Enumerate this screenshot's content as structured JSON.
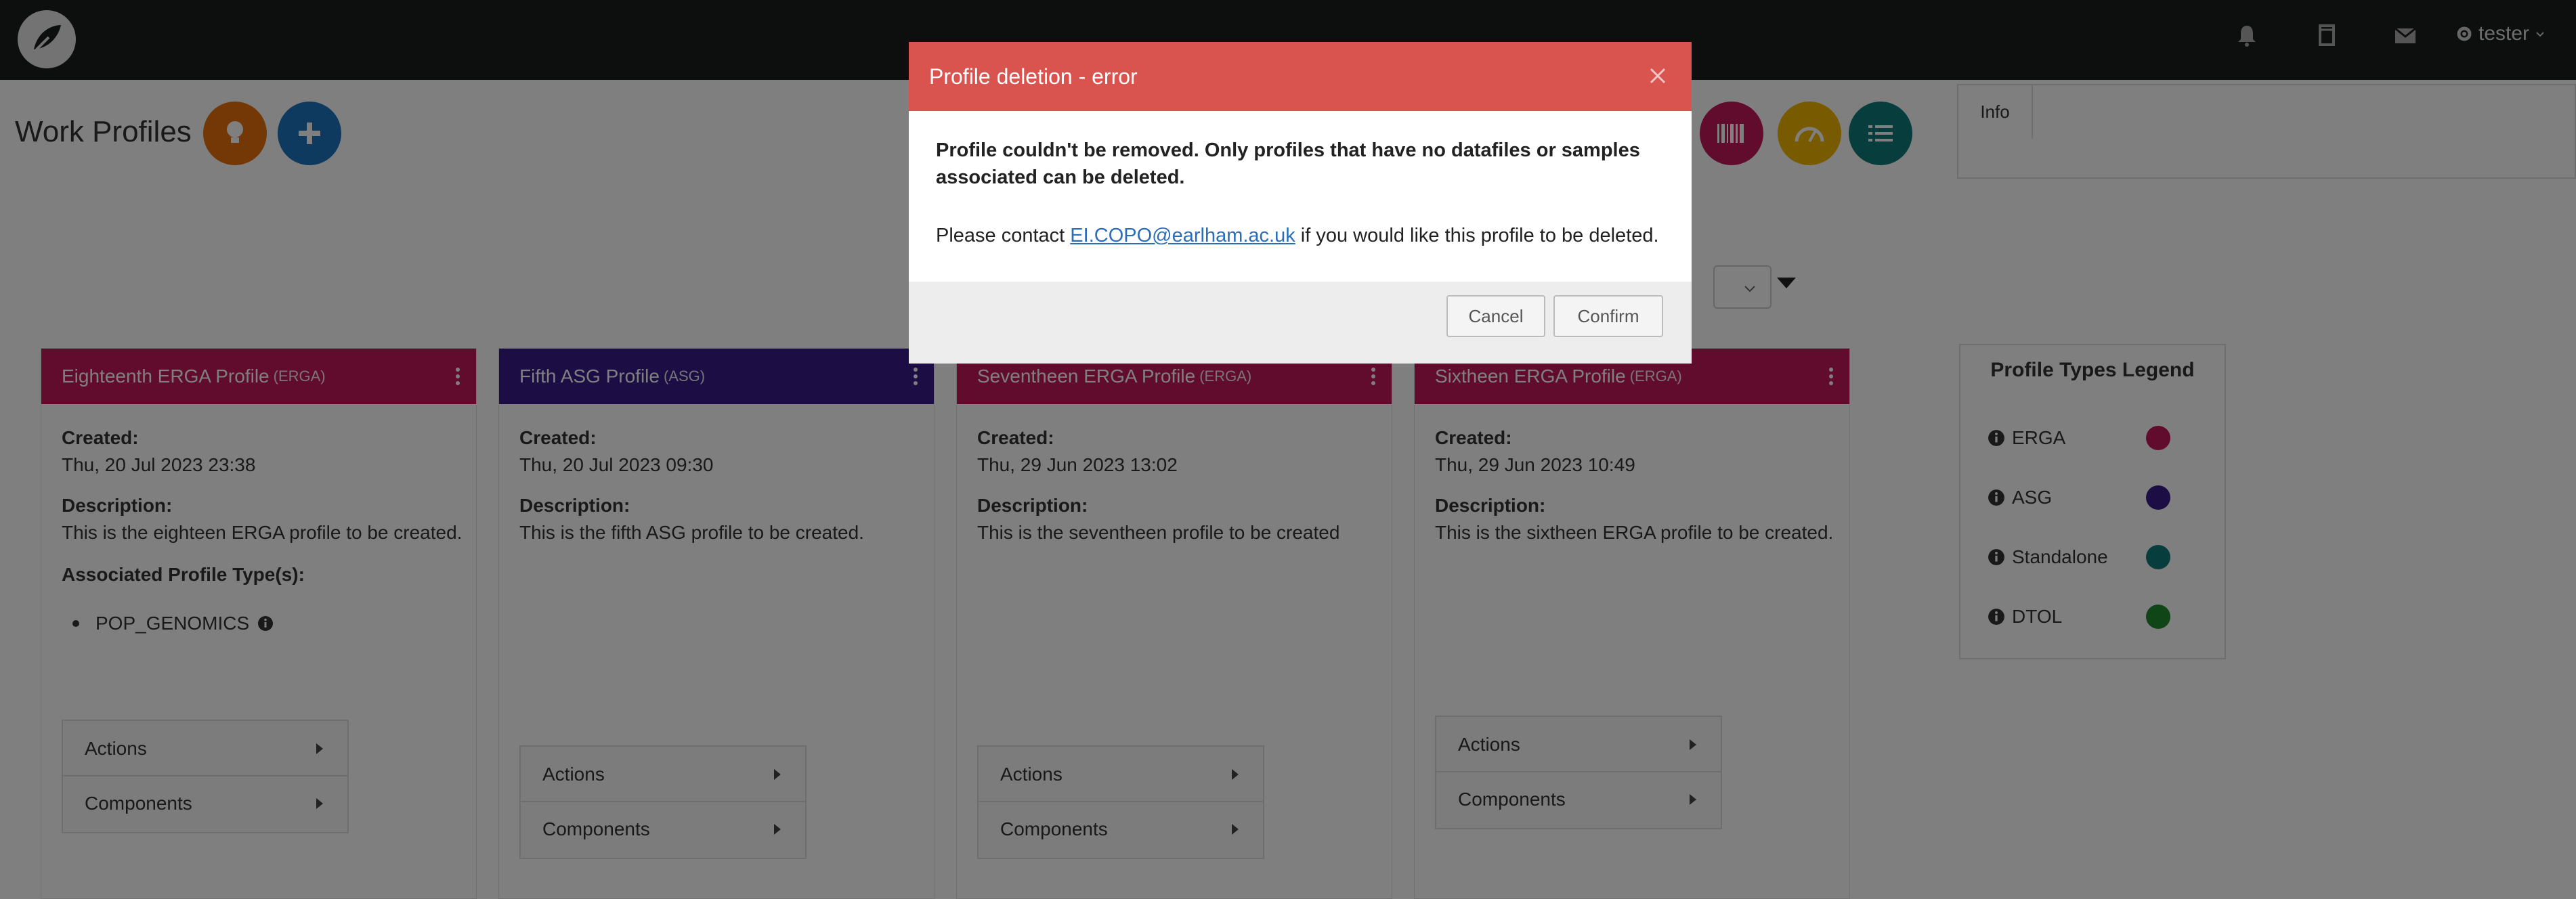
{
  "nav": {
    "user_label": "tester",
    "icons": [
      "bell-icon",
      "book-icon",
      "envelope-icon",
      "gear-icon"
    ]
  },
  "header": {
    "title": "Work Profiles",
    "info_tab": "Info"
  },
  "colors": {
    "erga": "#c2185b",
    "asg": "#3b1a8a",
    "standalone": "#0e7c7b",
    "dtol": "#1e8a2e",
    "error": "#d9534f",
    "orange": "#e8700f",
    "blue": "#1b75bc",
    "yellow": "#f0b400"
  },
  "cards": [
    {
      "title": "Eighteenth ERGA Profile",
      "type": "(ERGA)",
      "created_label": "Created:",
      "created": "Thu, 20 Jul 2023 23:38",
      "description_label": "Description:",
      "description": "This is the eighteen ERGA profile to be created.",
      "assoc_label": "Associated Profile Type(s):",
      "assoc_item": "POP_GENOMICS",
      "actions": "Actions",
      "components": "Components"
    },
    {
      "title": "Fifth ASG Profile",
      "type": "(ASG)",
      "created_label": "Created:",
      "created": "Thu, 20 Jul 2023 09:30",
      "description_label": "Description:",
      "description": "This is the fifth ASG profile to be created.",
      "actions": "Actions",
      "components": "Components"
    },
    {
      "title": "Seventheen ERGA Profile",
      "type": "(ERGA)",
      "created_label": "Created:",
      "created": "Thu, 29 Jun 2023 13:02",
      "description_label": "Description:",
      "description": "This is the seventheen profile to be created",
      "actions": "Actions",
      "components": "Components"
    },
    {
      "title": "Sixtheen ERGA Profile",
      "type": "(ERGA)",
      "created_label": "Created:",
      "created": "Thu, 29 Jun 2023 10:49",
      "description_label": "Description:",
      "description": "This is the sixtheen ERGA profile to be created.",
      "actions": "Actions",
      "components": "Components"
    }
  ],
  "legend": {
    "title": "Profile Types Legend",
    "items": [
      "ERGA",
      "ASG",
      "Standalone",
      "DTOL"
    ]
  },
  "modal": {
    "title": "Profile deletion - error",
    "message": "Profile couldn't be removed. Only profiles that have no datafiles or samples associated can be deleted.",
    "contact_prefix": "Please contact ",
    "contact_email": "EI.COPO@earlham.ac.uk",
    "contact_suffix": " if you would like this profile to be deleted.",
    "cancel": "Cancel",
    "confirm": "Confirm"
  }
}
